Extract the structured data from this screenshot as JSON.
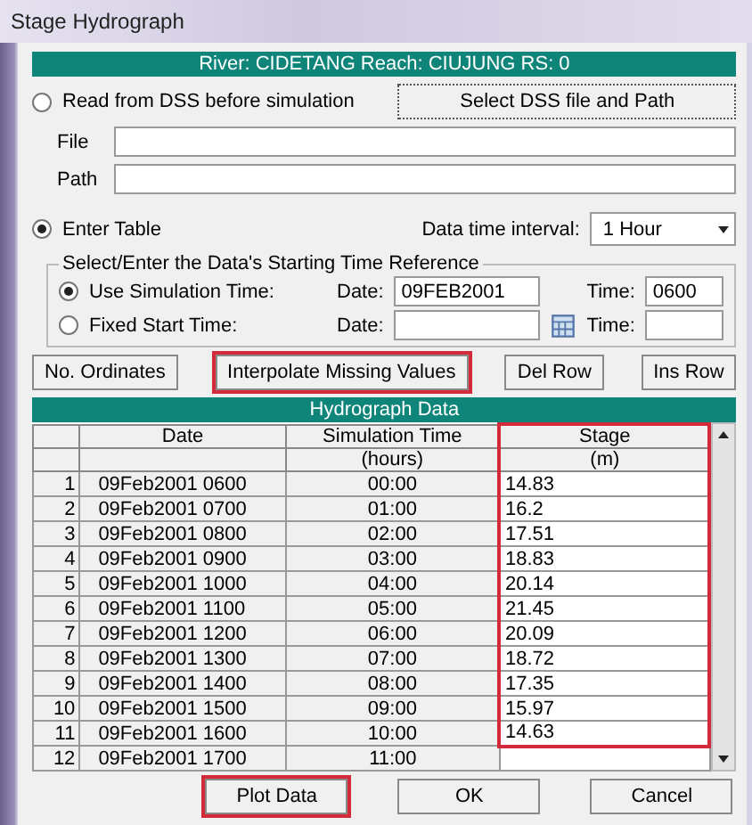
{
  "window": {
    "title": "Stage Hydrograph"
  },
  "location": "River: CIDETANG  Reach: CIUJUNG  RS: 0",
  "dss": {
    "radio_label": "Read from DSS before simulation",
    "selected": false,
    "button": "Select DSS file and Path",
    "file_label": "File",
    "path_label": "Path"
  },
  "table_source": {
    "radio_label": "Enter Table",
    "selected": true,
    "interval_label": "Data time interval:",
    "interval": "1 Hour"
  },
  "time_reference": {
    "legend": "Select/Enter the Data's Starting Time Reference",
    "options": [
      {
        "label": "Use Simulation Time:",
        "selected": true,
        "date_label": "Date:",
        "date": "09FEB2001",
        "time_label": "Time:",
        "time": "0600"
      },
      {
        "label": "Fixed Start Time:",
        "selected": false,
        "date_label": "Date:",
        "time_label": "Time:",
        "calendar": true
      }
    ]
  },
  "toolbar": [
    {
      "label": "No. Ordinates",
      "highlighted": false
    },
    {
      "label": "Interpolate Missing Values",
      "highlighted": true
    },
    {
      "label": "Del Row",
      "highlighted": false
    },
    {
      "label": "Ins Row",
      "highlighted": false
    }
  ],
  "table": {
    "title": "Hydrograph Data",
    "columns": [
      {
        "name": "Date",
        "highlighted": false
      },
      {
        "name": "Simulation Time",
        "unit": "(hours)",
        "highlighted": false
      },
      {
        "name": "Stage",
        "unit": "(m)",
        "highlighted": true
      }
    ],
    "rows": [
      {
        "number": "1",
        "date": "09Feb2001 0600",
        "time": "00:00",
        "stage": "14.83"
      },
      {
        "number": "2",
        "date": "09Feb2001 0700",
        "time": "01:00",
        "stage": "16.2"
      },
      {
        "number": "3",
        "date": "09Feb2001 0800",
        "time": "02:00",
        "stage": "17.51"
      },
      {
        "number": "4",
        "date": "09Feb2001 0900",
        "time": "03:00",
        "stage": "18.83"
      },
      {
        "number": "5",
        "date": "09Feb2001 1000",
        "time": "04:00",
        "stage": "20.14"
      },
      {
        "number": "6",
        "date": "09Feb2001 1100",
        "time": "05:00",
        "stage": "21.45"
      },
      {
        "number": "7",
        "date": "09Feb2001 1200",
        "time": "06:00",
        "stage": "20.09"
      },
      {
        "number": "8",
        "date": "09Feb2001 1300",
        "time": "07:00",
        "stage": "18.72"
      },
      {
        "number": "9",
        "date": "09Feb2001 1400",
        "time": "08:00",
        "stage": "17.35"
      },
      {
        "number": "10",
        "date": "09Feb2001 1500",
        "time": "09:00",
        "stage": "15.97"
      },
      {
        "number": "11",
        "date": "09Feb2001 1600",
        "time": "10:00",
        "stage": "14.63"
      },
      {
        "number": "12",
        "date": "09Feb2001 1700",
        "time": "11:00"
      }
    ]
  },
  "buttons": [
    {
      "label": "Plot Data",
      "highlighted": true
    },
    {
      "label": "OK",
      "highlighted": false
    },
    {
      "label": "Cancel",
      "highlighted": false
    }
  ]
}
